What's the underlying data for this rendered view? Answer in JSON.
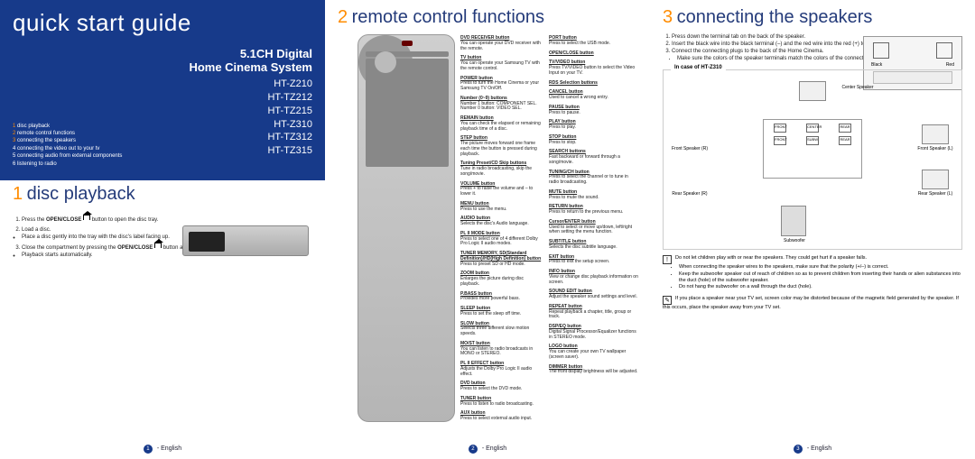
{
  "panel1": {
    "title": "quick start guide",
    "digital": "5.1CH Digital",
    "system": "Home Cinema System",
    "models": [
      "HT-Z210",
      "HT-TZ212",
      "HT-TZ215",
      "HT-Z310",
      "HT-TZ312",
      "HT-TZ315"
    ],
    "toc": [
      {
        "n": "1",
        "t": "disc playback"
      },
      {
        "n": "2",
        "t": "remote control functions"
      },
      {
        "n": "3",
        "t": "connecting the speakers"
      },
      {
        "n": "4",
        "t": "connecting the video out to your tv"
      },
      {
        "n": "5",
        "t": "connecting audio from external components"
      },
      {
        "n": "6",
        "t": "listening to radio"
      }
    ],
    "sec_num": "1",
    "sec_title": "disc playback",
    "steps": [
      {
        "pre": "Press the ",
        "b": "OPEN/CLOSE",
        "post": " button to open the disc tray."
      },
      {
        "pre": "Load a disc.",
        "b": "",
        "post": ""
      },
      {
        "pre": "Close the compartment by pressing the ",
        "b": "OPEN/CLOSE",
        "post": " button again."
      }
    ],
    "sub_bullet1": "Place a disc gently into the tray with the disc's label facing up.",
    "sub_bullet2": "Playback starts automatically.",
    "footer_page": "1",
    "footer_lang": "- English"
  },
  "panel2": {
    "sec_num": "2",
    "sec_title": "remote control functions",
    "left": [
      {
        "t": "DVD RECEIVER button",
        "d": "You can operate your DVD receiver with the remote."
      },
      {
        "t": "TV button",
        "d": "You can operate your Samsung TV with the remote control."
      },
      {
        "t": "POWER button",
        "d": "Press to turn the Home Cinema or your Samsung TV On/Off."
      },
      {
        "t": "Number (0~9) buttons",
        "d": "Number 1 button: COMPONENT SEL. Number 0 button: VIDEO SEL."
      },
      {
        "t": "REMAIN button",
        "d": "You can check the elapsed or remaining playback time of a disc."
      },
      {
        "t": "STEP button",
        "d": "The picture moves forward one frame each time the button is pressed during playback."
      },
      {
        "t": "Tuning Preset/CD Skip buttons",
        "d": "Tune in radio broadcasting, skip the song/movie."
      },
      {
        "t": "VOLUME button",
        "d": "Press + to raise the volume and – to lower it."
      },
      {
        "t": "MENU button",
        "d": "Press to use the menu."
      },
      {
        "t": "AUDIO button",
        "d": "Selects the disc's Audio language."
      },
      {
        "t": "PL II MODE button",
        "d": "Press to select one of 4 different Dolby Pro Logic II audio modes."
      },
      {
        "t": "TUNER MEMORY, SD(Standard Definition)/HD(High Definition) button",
        "d": "Press to preset SD or HD mode."
      },
      {
        "t": "ZOOM button",
        "d": "Enlarges the picture during disc playback."
      },
      {
        "t": "P.BASS button",
        "d": "Provides more powerful bass."
      },
      {
        "t": "SLEEP button",
        "d": "Press to set the sleep off time."
      },
      {
        "t": "SLOW button",
        "d": "Selects three different slow motion speeds."
      },
      {
        "t": "MO/ST button",
        "d": "You can listen to radio broadcasts in MONO or STEREO."
      },
      {
        "t": "PL II EFFECT button",
        "d": "Adjusts the Dolby Pro Logic II audio effect."
      },
      {
        "t": "DVD button",
        "d": "Press to select the DVD mode."
      },
      {
        "t": "TUNER button",
        "d": "Press to listen to radio broadcasting."
      },
      {
        "t": "AUX button",
        "d": "Press to select external audio input."
      }
    ],
    "right": [
      {
        "t": "PORT button",
        "d": "Press to select the USB mode."
      },
      {
        "t": "OPEN/CLOSE button",
        "d": ""
      },
      {
        "t": "TV/VIDEO button",
        "d": "Press TV/VIDEO button to select the Video Input on your TV."
      },
      {
        "t": "RDS Selection buttons",
        "d": ""
      },
      {
        "t": "CANCEL button",
        "d": "Used to cancel a wrong entry."
      },
      {
        "t": "PAUSE button",
        "d": "Press to pause."
      },
      {
        "t": "PLAY button",
        "d": "Press to play."
      },
      {
        "t": "STOP button",
        "d": "Press to stop."
      },
      {
        "t": "SEARCH buttons",
        "d": "Fast backward or forward through a song/movie."
      },
      {
        "t": "TUNING/CH button",
        "d": "Press to select the channel or to tune in radio broadcasting."
      },
      {
        "t": "MUTE button",
        "d": "Press to mute the sound."
      },
      {
        "t": "RETURN button",
        "d": "Press to return to the previous menu."
      },
      {
        "t": "Cursor/ENTER button",
        "d": "Used to select or move up/down, left/right when setting the menu function."
      },
      {
        "t": "SUBTITLE button",
        "d": "Selects the disc subtitle language."
      },
      {
        "t": "EXIT button",
        "d": "Press to exit the setup screen."
      },
      {
        "t": "INFO button",
        "d": "View or change disc playback information on screen."
      },
      {
        "t": "SOUND EDIT button",
        "d": "Adjust the speaker sound settings and level."
      },
      {
        "t": "REPEAT button",
        "d": "Repeat playback a chapter, title, group or track."
      },
      {
        "t": "DSP/EQ button",
        "d": "Digital Signal Processor/Equalizer functions in STEREO mode."
      },
      {
        "t": "LOGO button",
        "d": "You can create your own TV wallpaper (screen saver)."
      },
      {
        "t": "DIMMER button",
        "d": "The front display brightness will be adjusted."
      }
    ],
    "footer_page": "2",
    "footer_lang": "- English"
  },
  "panel3": {
    "sec_num": "3",
    "sec_title": "connecting the speakers",
    "steps": [
      "Press down the terminal tab on the back of the speaker.",
      "Insert the black wire into the black terminal (–) and the red wire into the red (+) terminal, and then release the tab.",
      "Connect the connecting plugs to the back of the Home Cinema."
    ],
    "step3_bullet": "Make sure the colors of the speaker terminals match the colors of the connecting plugs.",
    "term_black": "Black",
    "term_red": "Red",
    "diag_title": "In case of HT-Z310",
    "labels": {
      "cs": "Center Speaker",
      "fr": "Front Speaker (R)",
      "fl": "Front Speaker (L)",
      "rr": "Rear Speaker (R)",
      "rl": "Rear Speaker (L)",
      "sub": "Subwoofer"
    },
    "hub_row1": [
      "FRONT",
      "CENTER",
      "REAR"
    ],
    "hub_row2": [
      "FRONT",
      "SUBW",
      "REAR"
    ],
    "notes1_lead": "Do not let children play with or near the speakers. They could get hurt if a speaker falls.",
    "notes1_b": [
      "When connecting the speaker wires to the speakers, make sure that the polarity (+/–) is correct.",
      "Keep the subwoofer speaker out of reach of children so as to prevent children from inserting their hands or alien substances into the duct (hole) of the subwoofer speaker.",
      "Do not hang the subwoofer on a wall through the duct (hole)."
    ],
    "notes2": "If you place a speaker near your TV set, screen color may be distorted because of the magnetic field generated by the speaker. If this occurs, place the speaker away from your TV set.",
    "footer_page": "3",
    "footer_lang": "- English"
  }
}
